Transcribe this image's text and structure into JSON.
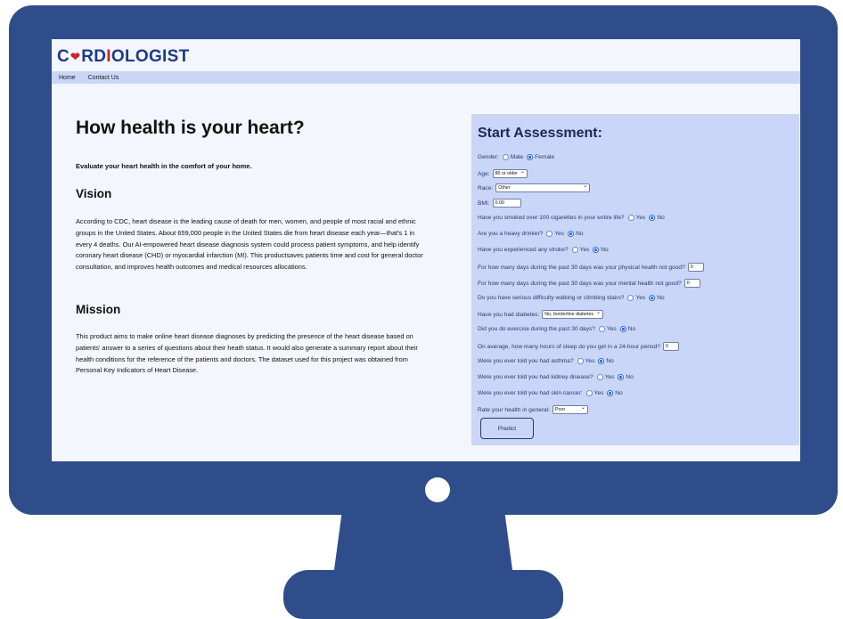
{
  "header": {
    "brand_pre": "C",
    "brand_mid": "RD",
    "brand_red": "I",
    "brand_post": "OLOGIST"
  },
  "nav": {
    "items": [
      "Home",
      "Contact Us"
    ]
  },
  "main": {
    "title": "How health is your heart?",
    "subtitle": "Evaluate your heart health in the comfort of your home.",
    "vision_heading": "Vision",
    "vision_text": "According to CDC, heart disease is the leading cause of death for men, women, and people of most racial and ethnic groups in the United States. About 659,000 people in the United States die from heart disease each year—that's 1 in every 4 deaths. Our AI-empowered heart disease diagnosis system could process patient symptoms, and help identify coronary heart disease (CHD) or myocardial infarction (MI). This productsaves patients time and cost for general doctor consultation, and improves health outcomes and medical resources allocations.",
    "mission_heading": "Mission",
    "mission_text": "This product aims to make online heart disease diagnoses by predicting the presence of the heart disease based on patients' answer to a series of questions about their heath status. It would also generate a summary report about their health conditions for the reference of the patients and doctors. The dataset used for this project was obtained from Personal Key Indicators of Heart Disease."
  },
  "form": {
    "title": "Start Assessment:",
    "gender_label": "Gender:",
    "gender_opt1": "Male",
    "gender_opt2": "Female",
    "age_label": "Age:",
    "age_value": "80 or older",
    "race_label": "Race:",
    "race_value": "Other",
    "bmi_label": "BMI:",
    "bmi_value": "0.00",
    "smoke_label": "Have you smoked over 100 cigarettes in your entire life?",
    "drinker_label": "Are you a heavy drinker?",
    "stroke_label": "Have you experienced any stroke?",
    "physical_label": "For how many days during the past 30 days was your physical health not good?",
    "physical_value": "0",
    "mental_label": "For how many days during the past 30 days was your mental health not good?",
    "mental_value": "0",
    "walking_label": "Do you have serious difficulty walking or climbing stairs?",
    "diabetes_label": "Have you had diabetes:",
    "diabetes_value": "No, borderline diabetes",
    "exercise_label": "Did you do exercise during the past 30 days?",
    "sleep_label": "On average, how many hours of sleep do you get in a 24-hour period?",
    "sleep_value": "0",
    "asthma_label": "Were you ever told you had asthma?",
    "kidney_label": "Were you ever told you had kidney disease?",
    "cancer_label": "Were you ever told you had skin cancer:",
    "health_label": "Rate your health in general:",
    "health_value": "Poor",
    "yes": "Yes",
    "no": "No",
    "predict_button": "Predict"
  }
}
